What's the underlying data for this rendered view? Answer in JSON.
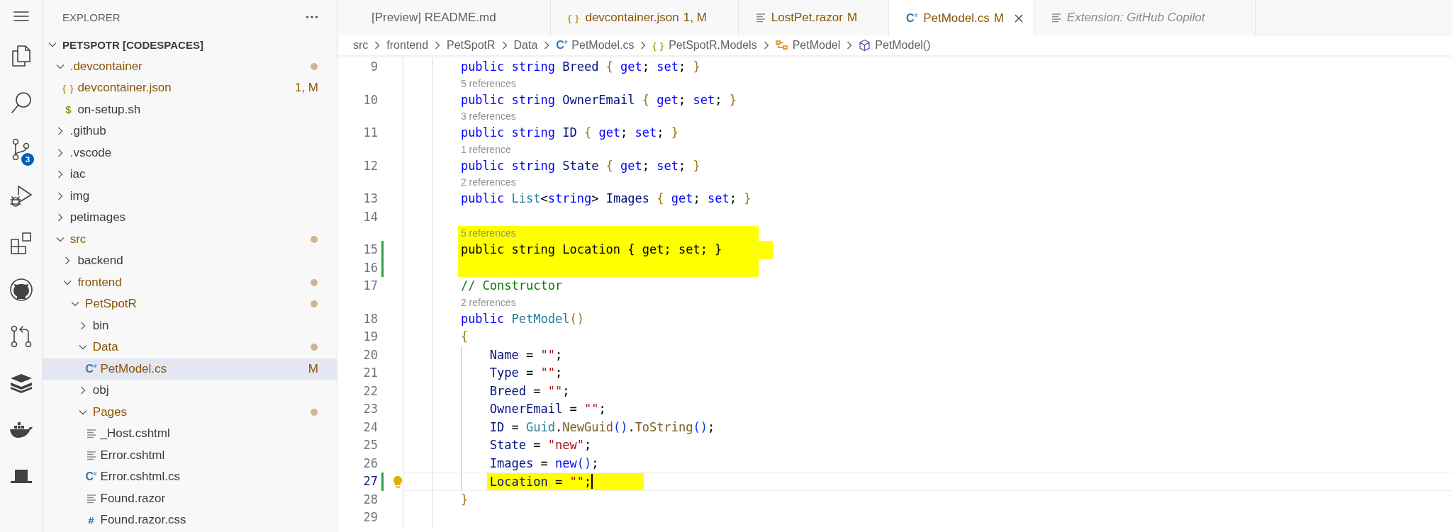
{
  "activity_bar": [
    {
      "kind": "menu"
    },
    {
      "kind": "files"
    },
    {
      "kind": "search"
    },
    {
      "kind": "source-control",
      "badge": "3"
    },
    {
      "kind": "run-debug"
    },
    {
      "kind": "extensions"
    },
    {
      "kind": "cat"
    },
    {
      "kind": "pull-request"
    },
    {
      "kind": "layers"
    },
    {
      "kind": "whale"
    },
    {
      "kind": "hat"
    }
  ],
  "sidebar": {
    "title": "EXPLORER",
    "tree": {
      "label": "PETSPOTR [CODESPACES]",
      "kind": "folder",
      "expanded": true,
      "modified": false,
      "selected": false,
      "children": [
        {
          "label": ".devcontainer",
          "kind": "folder",
          "expanded": true,
          "modified": true,
          "selected": false,
          "children": [
            {
              "label": "devcontainer.json",
              "kind": "file",
              "icon": {
                "kind": "json",
                "glyph": "{ }"
              },
              "modified": true,
              "badge": "1, M",
              "selected": false
            },
            {
              "label": "on-setup.sh",
              "kind": "file",
              "icon": {
                "kind": "shell",
                "glyph": "$"
              },
              "modified": false,
              "selected": false
            }
          ]
        },
        {
          "label": ".github",
          "kind": "folder",
          "expanded": false,
          "modified": false,
          "selected": false
        },
        {
          "label": ".vscode",
          "kind": "folder",
          "expanded": false,
          "modified": false,
          "selected": false
        },
        {
          "label": "iac",
          "kind": "folder",
          "expanded": false,
          "modified": false,
          "selected": false
        },
        {
          "label": "img",
          "kind": "folder",
          "expanded": false,
          "modified": false,
          "selected": false
        },
        {
          "label": "petimages",
          "kind": "folder",
          "expanded": false,
          "modified": false,
          "selected": false
        },
        {
          "label": "src",
          "kind": "folder",
          "expanded": true,
          "modified": true,
          "selected": false,
          "children": [
            {
              "label": "backend",
              "kind": "folder",
              "expanded": false,
              "modified": false,
              "selected": false
            },
            {
              "label": "frontend",
              "kind": "folder",
              "expanded": true,
              "modified": true,
              "selected": false,
              "children": [
                {
                  "label": "PetSpotR",
                  "kind": "folder",
                  "expanded": true,
                  "modified": true,
                  "selected": false,
                  "children": [
                    {
                      "label": "bin",
                      "kind": "folder",
                      "expanded": false,
                      "modified": false,
                      "selected": false
                    },
                    {
                      "label": "Data",
                      "kind": "folder",
                      "expanded": true,
                      "modified": true,
                      "selected": false,
                      "children": [
                        {
                          "label": "PetModel.cs",
                          "kind": "file",
                          "icon": {
                            "kind": "csharp",
                            "glyph": "C$^{#}$"
                          },
                          "modified": true,
                          "badge": "M",
                          "selected": true
                        }
                      ]
                    },
                    {
                      "label": "obj",
                      "kind": "folder",
                      "expanded": false,
                      "modified": false,
                      "selected": false
                    },
                    {
                      "label": "Pages",
                      "kind": "folder",
                      "expanded": true,
                      "modified": true,
                      "selected": false,
                      "children": [
                        {
                          "label": "_Host.cshtml",
                          "kind": "file",
                          "icon": {
                            "kind": "lines"
                          },
                          "modified": false,
                          "selected": false
                        },
                        {
                          "label": "Error.cshtml",
                          "kind": "file",
                          "icon": {
                            "kind": "lines"
                          },
                          "modified": false,
                          "selected": false
                        },
                        {
                          "label": "Error.cshtml.cs",
                          "kind": "file",
                          "icon": {
                            "kind": "csharp",
                            "glyph": "C$^{#}$"
                          },
                          "modified": false,
                          "selected": false
                        },
                        {
                          "label": "Found.razor",
                          "kind": "file",
                          "icon": {
                            "kind": "lines"
                          },
                          "modified": false,
                          "selected": false
                        },
                        {
                          "label": "Found.razor.css",
                          "kind": "file",
                          "icon": {
                            "kind": "css",
                            "glyph": "#"
                          },
                          "modified": false,
                          "selected": false
                        }
                      ]
                    }
                  ]
                }
              ]
            }
          ]
        }
      ]
    }
  },
  "tabs": [
    {
      "label": "[Preview] README.md",
      "selected": false,
      "preview": false
    },
    {
      "label": "devcontainer.json",
      "icon": {
        "kind": "json",
        "glyph": "{ }"
      },
      "badge": "1, M",
      "selected": false,
      "preview": false
    },
    {
      "label": "LostPet.razor",
      "icon": {
        "kind": "lines"
      },
      "badge": "M",
      "selected": false,
      "preview": false
    },
    {
      "label": "PetModel.cs",
      "icon": {
        "kind": "csharp",
        "glyph": "C$^{#}$"
      },
      "badge": "M",
      "selected": true,
      "preview": false
    },
    {
      "label": "Extension: GitHub Copilot",
      "icon": {
        "kind": "lines"
      },
      "selected": false,
      "preview": true
    }
  ],
  "breadcrumb": [
    {
      "label": "src"
    },
    {
      "label": "frontend"
    },
    {
      "label": "PetSpotR"
    },
    {
      "label": "Data"
    },
    {
      "label": "PetModel.cs",
      "icon": {
        "kind": "csharp",
        "glyph": "C$^{#}$"
      }
    },
    {
      "label": "PetSpotR.Models",
      "icon": {
        "kind": "namespace",
        "glyph": "{ }"
      }
    },
    {
      "label": "PetModel",
      "icon": {
        "kind": "class"
      }
    },
    {
      "label": "PetModel()",
      "icon": {
        "kind": "method"
      }
    }
  ],
  "editor": {
    "lines": [
      {
        "kind": "code",
        "number": "9",
        "changed": false,
        "highlight": false,
        "current": false,
        "cursor": false,
        "lightbulb": false,
        "tokens": [
          {
            "kind": "kw",
            "text": "public string"
          },
          {
            "kind": "prop",
            "text": " Breed "
          },
          {
            "kind": "bracket",
            "text": "{"
          },
          {
            "kind": "kw",
            "text": " get"
          },
          {
            "kind": "plain",
            "text": ";"
          },
          {
            "kind": "kw",
            "text": " set"
          },
          {
            "kind": "plain",
            "text": "; "
          },
          {
            "kind": "bracket",
            "text": "}"
          }
        ]
      },
      {
        "kind": "lens",
        "text": "5 references",
        "highlight": false
      },
      {
        "kind": "code",
        "number": "10",
        "changed": false,
        "highlight": false,
        "current": false,
        "cursor": false,
        "lightbulb": false,
        "tokens": [
          {
            "kind": "kw",
            "text": "public string"
          },
          {
            "kind": "prop",
            "text": " OwnerEmail "
          },
          {
            "kind": "bracket",
            "text": "{"
          },
          {
            "kind": "kw",
            "text": " get"
          },
          {
            "kind": "plain",
            "text": ";"
          },
          {
            "kind": "kw",
            "text": " set"
          },
          {
            "kind": "plain",
            "text": "; "
          },
          {
            "kind": "bracket",
            "text": "}"
          }
        ]
      },
      {
        "kind": "lens",
        "text": "3 references",
        "highlight": false
      },
      {
        "kind": "code",
        "number": "11",
        "changed": false,
        "highlight": false,
        "current": false,
        "cursor": false,
        "lightbulb": false,
        "tokens": [
          {
            "kind": "kw",
            "text": "public string"
          },
          {
            "kind": "prop",
            "text": " ID "
          },
          {
            "kind": "bracket",
            "text": "{"
          },
          {
            "kind": "kw",
            "text": " get"
          },
          {
            "kind": "plain",
            "text": ";"
          },
          {
            "kind": "kw",
            "text": " set"
          },
          {
            "kind": "plain",
            "text": "; "
          },
          {
            "kind": "bracket",
            "text": "}"
          }
        ]
      },
      {
        "kind": "lens",
        "text": "1 reference",
        "highlight": false
      },
      {
        "kind": "code",
        "number": "12",
        "changed": false,
        "highlight": false,
        "current": false,
        "cursor": false,
        "lightbulb": false,
        "tokens": [
          {
            "kind": "kw",
            "text": "public string"
          },
          {
            "kind": "prop",
            "text": " State "
          },
          {
            "kind": "bracket",
            "text": "{"
          },
          {
            "kind": "kw",
            "text": " get"
          },
          {
            "kind": "plain",
            "text": ";"
          },
          {
            "kind": "kw",
            "text": " set"
          },
          {
            "kind": "plain",
            "text": "; "
          },
          {
            "kind": "bracket",
            "text": "}"
          }
        ]
      },
      {
        "kind": "lens",
        "text": "2 references",
        "highlight": false
      },
      {
        "kind": "code",
        "number": "13",
        "changed": false,
        "highlight": false,
        "current": false,
        "cursor": false,
        "lightbulb": false,
        "tokens": [
          {
            "kind": "kw",
            "text": "public"
          },
          {
            "kind": "type",
            "text": " List"
          },
          {
            "kind": "plain",
            "text": "<"
          },
          {
            "kind": "kw",
            "text": "string"
          },
          {
            "kind": "plain",
            "text": ">"
          },
          {
            "kind": "prop",
            "text": " Images "
          },
          {
            "kind": "bracket",
            "text": "{"
          },
          {
            "kind": "kw",
            "text": " get"
          },
          {
            "kind": "plain",
            "text": ";"
          },
          {
            "kind": "kw",
            "text": " set"
          },
          {
            "kind": "plain",
            "text": "; "
          },
          {
            "kind": "bracket",
            "text": "}"
          }
        ]
      },
      {
        "kind": "code",
        "number": "14",
        "changed": false,
        "highlight": false,
        "current": false,
        "cursor": false,
        "lightbulb": false
      },
      {
        "kind": "lens",
        "text": "5 references",
        "highlight": true
      },
      {
        "kind": "code",
        "number": "15",
        "changed": true,
        "highlight": true,
        "current": false,
        "cursor": false,
        "lightbulb": false,
        "tokens": [
          {
            "kind": "plain",
            "text": "public string Location { get; set; }"
          }
        ]
      },
      {
        "kind": "code",
        "number": "16",
        "changed": true,
        "highlight": true,
        "current": false,
        "cursor": false,
        "lightbulb": false
      },
      {
        "kind": "code",
        "number": "17",
        "changed": false,
        "highlight": false,
        "current": false,
        "cursor": false,
        "lightbulb": false,
        "tokens": [
          {
            "kind": "comment",
            "text": "// Constructor"
          }
        ]
      },
      {
        "kind": "lens",
        "text": "2 references",
        "highlight": false
      },
      {
        "kind": "code",
        "number": "18",
        "changed": false,
        "highlight": false,
        "current": false,
        "cursor": false,
        "lightbulb": false,
        "tokens": [
          {
            "kind": "kw",
            "text": "public"
          },
          {
            "kind": "type",
            "text": " PetModel"
          },
          {
            "kind": "bracket",
            "text": "()"
          }
        ]
      },
      {
        "kind": "code",
        "number": "19",
        "changed": false,
        "highlight": false,
        "current": false,
        "cursor": false,
        "lightbulb": false,
        "tokens": [
          {
            "kind": "bracket",
            "text": "{"
          }
        ],
        "children": [
          {
            "kind": "code",
            "number": "20",
            "changed": false,
            "highlight": false,
            "current": false,
            "cursor": false,
            "lightbulb": false,
            "tokens": [
              {
                "kind": "prop",
                "text": "Name"
              },
              {
                "kind": "plain",
                "text": " = "
              },
              {
                "kind": "str",
                "text": "\"\""
              },
              {
                "kind": "plain",
                "text": ";"
              }
            ]
          },
          {
            "kind": "code",
            "number": "21",
            "changed": false,
            "highlight": false,
            "current": false,
            "cursor": false,
            "lightbulb": false,
            "tokens": [
              {
                "kind": "prop",
                "text": "Type"
              },
              {
                "kind": "plain",
                "text": " = "
              },
              {
                "kind": "str",
                "text": "\"\""
              },
              {
                "kind": "plain",
                "text": ";"
              }
            ]
          },
          {
            "kind": "code",
            "number": "22",
            "changed": false,
            "highlight": false,
            "current": false,
            "cursor": false,
            "lightbulb": false,
            "tokens": [
              {
                "kind": "prop",
                "text": "Breed"
              },
              {
                "kind": "plain",
                "text": " = "
              },
              {
                "kind": "str",
                "text": "\"\""
              },
              {
                "kind": "plain",
                "text": ";"
              }
            ]
          },
          {
            "kind": "code",
            "number": "23",
            "changed": false,
            "highlight": false,
            "current": false,
            "cursor": false,
            "lightbulb": false,
            "tokens": [
              {
                "kind": "prop",
                "text": "OwnerEmail"
              },
              {
                "kind": "plain",
                "text": " = "
              },
              {
                "kind": "str",
                "text": "\"\""
              },
              {
                "kind": "plain",
                "text": ";"
              }
            ]
          },
          {
            "kind": "code",
            "number": "24",
            "changed": false,
            "highlight": false,
            "current": false,
            "cursor": false,
            "lightbulb": false,
            "tokens": [
              {
                "kind": "prop",
                "text": "ID"
              },
              {
                "kind": "plain",
                "text": " = "
              },
              {
                "kind": "type",
                "text": "Guid"
              },
              {
                "kind": "plain",
                "text": "."
              },
              {
                "kind": "method",
                "text": "NewGuid"
              },
              {
                "kind": "bracket2",
                "text": "()"
              },
              {
                "kind": "plain",
                "text": "."
              },
              {
                "kind": "method",
                "text": "ToString"
              },
              {
                "kind": "bracket2",
                "text": "()"
              },
              {
                "kind": "plain",
                "text": ";"
              }
            ]
          },
          {
            "kind": "code",
            "number": "25",
            "changed": false,
            "highlight": false,
            "current": false,
            "cursor": false,
            "lightbulb": false,
            "tokens": [
              {
                "kind": "prop",
                "text": "State"
              },
              {
                "kind": "plain",
                "text": " = "
              },
              {
                "kind": "str",
                "text": "\"new\""
              },
              {
                "kind": "plain",
                "text": ";"
              }
            ]
          },
          {
            "kind": "code",
            "number": "26",
            "changed": false,
            "highlight": false,
            "current": false,
            "cursor": false,
            "lightbulb": false,
            "tokens": [
              {
                "kind": "prop",
                "text": "Images"
              },
              {
                "kind": "plain",
                "text": " = "
              },
              {
                "kind": "kw",
                "text": "new"
              },
              {
                "kind": "bracket2",
                "text": "()"
              },
              {
                "kind": "plain",
                "text": ";"
              }
            ]
          },
          {
            "kind": "code",
            "number": "27",
            "changed": true,
            "highlight": true,
            "current": true,
            "cursor": true,
            "lightbulb": true,
            "tokens": [
              {
                "kind": "prop",
                "text": "Location"
              },
              {
                "kind": "plain",
                "text": " = "
              },
              {
                "kind": "str",
                "text": "\"\""
              },
              {
                "kind": "plain",
                "text": ";"
              }
            ]
          }
        ]
      },
      {
        "kind": "code",
        "number": "28",
        "changed": false,
        "highlight": false,
        "current": false,
        "cursor": false,
        "lightbulb": false,
        "tokens": [
          {
            "kind": "bracket",
            "text": "}"
          }
        ]
      },
      {
        "kind": "code",
        "number": "29",
        "changed": false,
        "highlight": false,
        "current": false,
        "cursor": false,
        "lightbulb": false
      }
    ]
  }
}
